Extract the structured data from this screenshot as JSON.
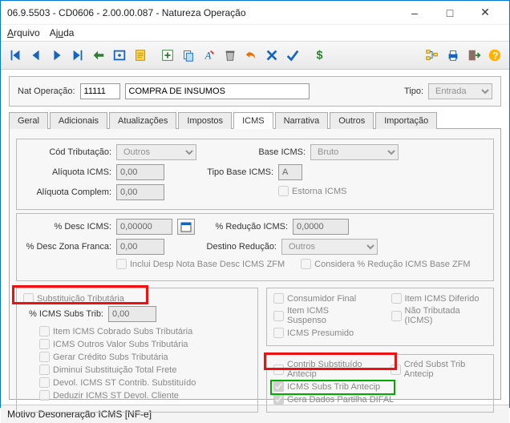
{
  "title": "06.9.5503 - CD0606 - 2.00.00.087 - Natureza Operação",
  "menu": {
    "arquivo": "Arquivo",
    "ajuda": "Ajuda"
  },
  "header": {
    "natOpLabel": "Nat Operação:",
    "natOpCode": "11111",
    "natOpDesc": "COMPRA DE INSUMOS",
    "tipoLabel": "Tipo:",
    "tipoValue": "Entrada"
  },
  "tabs": {
    "geral": "Geral",
    "adicionais": "Adicionais",
    "atualizacoes": "Atualizações",
    "impostos": "Impostos",
    "icms": "ICMS",
    "narrativa": "Narrativa",
    "outros": "Outros",
    "importacao": "Importação"
  },
  "icms": {
    "codTribLabel": "Cód Tributação:",
    "codTribValue": "Outros",
    "baseIcmsLabel": "Base ICMS:",
    "baseIcmsValue": "Bruto",
    "aliqIcmsLabel": "Alíquota ICMS:",
    "aliqIcmsValue": "0,00",
    "tipoBaseLabel": "Tipo Base ICMS:",
    "tipoBaseValue": "A",
    "aliqComplLabel": "Alíquota Complem:",
    "aliqComplValue": "0,00",
    "estornaIcms": "Estorna ICMS",
    "pctDescLabel": "% Desc ICMS:",
    "pctDescValue": "0,00000",
    "pctRedLabel": "% Redução ICMS:",
    "pctRedValue": "0,0000",
    "pctZFLabel": "% Desc Zona Franca:",
    "pctZFValue": "0,00",
    "destRedLabel": "Destino Redução:",
    "destRedValue": "Outros",
    "incluiDesp": "Inclui Desp Nota Base Desc ICMS ZFM",
    "consideraPct": "Considera % Redução ICMS Base ZFM"
  },
  "subsTrib": {
    "title": "Substituição Tributária",
    "pctLabel": "% ICMS Subs Trib:",
    "pctValue": "0,00",
    "items": [
      "Item ICMS Cobrado Subs Tributária",
      "ICMS Outros Valor Subs Tributária",
      "Gerar Crédito Subs Tributária",
      "Diminui Substituição Total Frete",
      "Devol. ICMS ST Contrib. Substituído",
      "Deduzir ICMS ST Devol. Cliente"
    ]
  },
  "right": {
    "consumidorFinal": "Consumidor Final",
    "itemDiferido": "Item ICMS Diferido",
    "itemSuspenso": "Item ICMS Suspenso",
    "naoTributada": "Não Tributada (ICMS)",
    "presumido": "ICMS Presumido",
    "contribSubst": "Contrib Substituído Antecip",
    "credSubst": "Créd Subst Trib Antecip",
    "subsAntecip": "ICMS Subs Trib Antecip",
    "geraDifal": "Gera Dados Partilha DIFAL"
  },
  "status": "Motivo Desoneração ICMS [NF-e]"
}
